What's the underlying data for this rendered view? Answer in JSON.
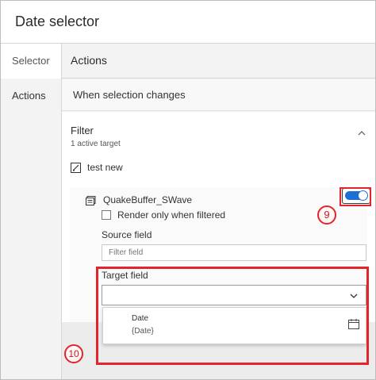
{
  "header": {
    "title": "Date selector"
  },
  "nav": {
    "items": [
      {
        "label": "Selector"
      },
      {
        "label": "Actions"
      }
    ]
  },
  "actions": {
    "heading": "Actions",
    "when_label": "When selection changes"
  },
  "filter": {
    "title": "Filter",
    "subtitle": "1 active target",
    "target_name": "test new",
    "layer_name": "QuakeBuffer_SWave",
    "toggle_on": true,
    "render_only_label": "Render only when filtered",
    "source_field_label": "Source field",
    "source_field_placeholder": "Filter field",
    "target_field_label": "Target field",
    "target_field_value": "",
    "dropdown_option": {
      "name": "Date",
      "type": "{Date}"
    }
  },
  "callouts": {
    "toggle": "9",
    "target": "10"
  },
  "colors": {
    "accent": "#1d6fd6",
    "callout": "#e3252b"
  }
}
